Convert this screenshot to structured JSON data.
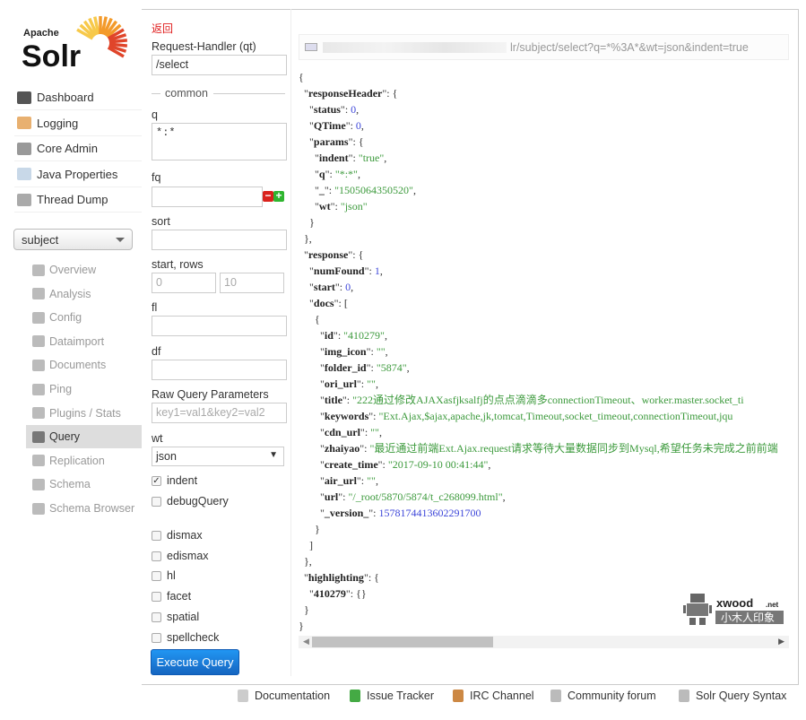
{
  "logo": {
    "top": "Apache",
    "main": "Solr"
  },
  "nav": [
    {
      "label": "Dashboard",
      "icon": "dashboard-icon"
    },
    {
      "label": "Logging",
      "icon": "logging-icon"
    },
    {
      "label": "Core Admin",
      "icon": "core-admin-icon"
    },
    {
      "label": "Java Properties",
      "icon": "java-properties-icon"
    },
    {
      "label": "Thread Dump",
      "icon": "thread-dump-icon"
    }
  ],
  "core_selector": "subject",
  "core_nav": [
    {
      "label": "Overview"
    },
    {
      "label": "Analysis"
    },
    {
      "label": "Config"
    },
    {
      "label": "Dataimport"
    },
    {
      "label": "Documents"
    },
    {
      "label": "Ping"
    },
    {
      "label": "Plugins / Stats"
    },
    {
      "label": "Query",
      "selected": true
    },
    {
      "label": "Replication"
    },
    {
      "label": "Schema"
    },
    {
      "label": "Schema Browser"
    }
  ],
  "form": {
    "back": "返回",
    "qt_label": "Request-Handler (qt)",
    "qt_value": "/select",
    "common": "common",
    "q_label": "q",
    "q_value": "*:*",
    "fq_label": "fq",
    "sort_label": "sort",
    "start_rows_label": "start, rows",
    "start_value": "0",
    "rows_value": "10",
    "fl_label": "fl",
    "df_label": "df",
    "raw_label": "Raw Query Parameters",
    "raw_placeholder": "key1=val1&key2=val2",
    "wt_label": "wt",
    "wt_value": "json",
    "indent": "indent",
    "debugQuery": "debugQuery",
    "dismax": "dismax",
    "edismax": "edismax",
    "hl": "hl",
    "facet": "facet",
    "spatial": "spatial",
    "spellcheck": "spellcheck",
    "execute": "Execute Query"
  },
  "result": {
    "url": "lr/subject/select?q=*%3A*&wt=json&indent=true",
    "lines": [
      {
        "i": 0,
        "t": "{"
      },
      {
        "i": 1,
        "k": "responseHeader",
        "t": "{"
      },
      {
        "i": 2,
        "k": "status",
        "v": "0",
        "vt": "n",
        "t": ","
      },
      {
        "i": 2,
        "k": "QTime",
        "v": "0",
        "vt": "n",
        "t": ","
      },
      {
        "i": 2,
        "k": "params",
        "t": "{"
      },
      {
        "i": 3,
        "k": "indent",
        "v": "\"true\"",
        "vt": "s",
        "t": ","
      },
      {
        "i": 3,
        "k": "q",
        "v": "\"*:*\"",
        "vt": "s",
        "t": ","
      },
      {
        "i": 3,
        "k": "_",
        "v": "\"1505064350520\"",
        "vt": "s",
        "t": ","
      },
      {
        "i": 3,
        "k": "wt",
        "v": "\"json\"",
        "vt": "s",
        "t": ""
      },
      {
        "i": 2,
        "t": "}"
      },
      {
        "i": 1,
        "t": "},"
      },
      {
        "i": 1,
        "k": "response",
        "t": "{"
      },
      {
        "i": 2,
        "k": "numFound",
        "v": "1",
        "vt": "n",
        "t": ","
      },
      {
        "i": 2,
        "k": "start",
        "v": "0",
        "vt": "n",
        "t": ","
      },
      {
        "i": 2,
        "k": "docs",
        "t": "["
      },
      {
        "i": 3,
        "t": "{"
      },
      {
        "i": 4,
        "k": "id",
        "v": "\"410279\"",
        "vt": "s",
        "t": ","
      },
      {
        "i": 4,
        "k": "img_icon",
        "v": "\"\"",
        "vt": "s",
        "t": ","
      },
      {
        "i": 4,
        "k": "folder_id",
        "v": "\"5874\"",
        "vt": "s",
        "t": ","
      },
      {
        "i": 4,
        "k": "ori_url",
        "v": "\"\"",
        "vt": "s",
        "t": ","
      },
      {
        "i": 4,
        "k": "title",
        "v": "\"222通过修改AJAXasfjksalfj的点点滴滴多connectionTimeout、worker.master.socket_ti",
        "vt": "s",
        "t": ""
      },
      {
        "i": 4,
        "k": "keywords",
        "v": "\"Ext.Ajax,$ajax,apache,jk,tomcat,Timeout,socket_timeout,connectionTimeout,jqu",
        "vt": "s",
        "t": ""
      },
      {
        "i": 4,
        "k": "cdn_url",
        "v": "\"\"",
        "vt": "s",
        "t": ","
      },
      {
        "i": 4,
        "k": "zhaiyao",
        "v": "\"最近通过前端Ext.Ajax.request请求等待大量数据同步到Mysql,希望任务未完成之前前端",
        "vt": "s",
        "t": ""
      },
      {
        "i": 4,
        "k": "create_time",
        "v": "\"2017-09-10 00:41:44\"",
        "vt": "s",
        "t": ","
      },
      {
        "i": 4,
        "k": "air_url",
        "v": "\"\"",
        "vt": "s",
        "t": ","
      },
      {
        "i": 4,
        "k": "url",
        "v": "\"/_root/5870/5874/t_c268099.html\"",
        "vt": "s",
        "t": ","
      },
      {
        "i": 4,
        "k": "_version_",
        "v": "1578174413602291700",
        "vt": "n",
        "t": ""
      },
      {
        "i": 3,
        "t": "}"
      },
      {
        "i": 2,
        "t": "]"
      },
      {
        "i": 1,
        "t": "},"
      },
      {
        "i": 1,
        "k": "highlighting",
        "t": "{"
      },
      {
        "i": 2,
        "k": "410279",
        "t": "{}"
      },
      {
        "i": 1,
        "t": "}"
      },
      {
        "i": 0,
        "t": "}"
      }
    ]
  },
  "watermark": {
    "brand": "xwood.net",
    "sub": "小木人印象"
  },
  "footer": [
    {
      "label": "Documentation",
      "icon": "documentation-icon"
    },
    {
      "label": "Issue Tracker",
      "icon": "bug-icon"
    },
    {
      "label": "IRC Channel",
      "icon": "irc-icon"
    },
    {
      "label": "Community forum",
      "icon": "mail-icon"
    },
    {
      "label": "Solr Query Syntax",
      "icon": "query-syntax-icon"
    }
  ],
  "colors": {
    "accent": "#1e88e5",
    "back_link": "#e02020",
    "string": "#3c9a3c",
    "number": "#3d46d9"
  }
}
